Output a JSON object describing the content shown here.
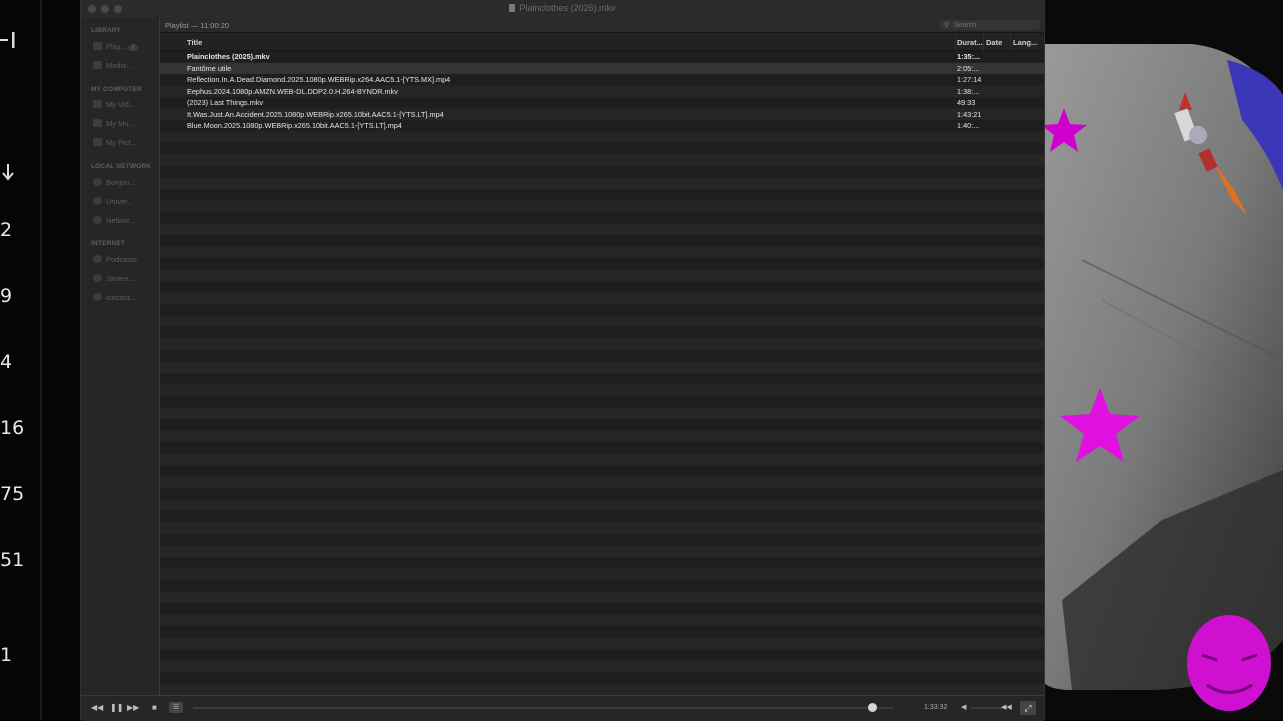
{
  "background_left": {
    "numbers": [
      "2",
      "9",
      "4",
      "16",
      "75",
      "51",
      "1"
    ]
  },
  "window": {
    "title": "Plainclothes (2026).mkv"
  },
  "sidebar": {
    "sections": [
      {
        "heading": "LIBRARY",
        "items": [
          {
            "label": "Play...",
            "icon": "playlist-icon",
            "badge": "7"
          },
          {
            "label": "Media...",
            "icon": "media-library-icon"
          }
        ]
      },
      {
        "heading": "MY COMPUTER",
        "items": [
          {
            "label": "My Vid...",
            "icon": "video-folder-icon"
          },
          {
            "label": "My Mu...",
            "icon": "music-note-icon"
          },
          {
            "label": "My Pict...",
            "icon": "picture-folder-icon"
          }
        ]
      },
      {
        "heading": "LOCAL NETWORK",
        "items": [
          {
            "label": "Bonjou...",
            "icon": "network-globe-icon"
          },
          {
            "label": "Univer...",
            "icon": "network-globe-icon"
          },
          {
            "label": "Networ...",
            "icon": "network-globe-icon"
          }
        ]
      },
      {
        "heading": "INTERNET",
        "items": [
          {
            "label": "Podcasts",
            "icon": "podcast-icon"
          },
          {
            "label": "Jamen...",
            "icon": "podcast-icon"
          },
          {
            "label": "Icecast...",
            "icon": "podcast-icon"
          }
        ]
      }
    ]
  },
  "playlist": {
    "header_label": "Playlist — 11:00:20",
    "search_placeholder": "Search",
    "columns": {
      "title": "Title",
      "duration": "Durat...",
      "date": "Date",
      "language": "Lang..."
    },
    "rows": [
      {
        "title": "Plainclothes (2025).mkv",
        "duration": "1:35:...",
        "playing": true
      },
      {
        "title": "Fantôme utile",
        "duration": "2:05:...",
        "selected": true
      },
      {
        "title": "Reflection.In.A.Dead.Diamond.2025.1080p.WEBRip.x264.AAC5.1-[YTS.MX].mp4",
        "duration": "1:27:14"
      },
      {
        "title": "Eephus.2024.1080p.AMZN.WEB-DL.DDP2.0.H.264-BYNDR.mkv",
        "duration": "1:38:..."
      },
      {
        "title": "(2023) Last Things.mkv",
        "duration": "49:33"
      },
      {
        "title": "It.Was.Just.An.Accident.2025.1080p.WEBRip.x265.10bit.AAC5.1-[YTS.LT].mp4",
        "duration": "1:43:21"
      },
      {
        "title": "Blue.Moon.2025.1080p.WEBRip.x265.10bit.AAC5.1-[YTS.LT].mp4",
        "duration": "1:40:..."
      }
    ]
  },
  "controls": {
    "rewind": "◀◀",
    "pause": "❚❚",
    "forward": "▶▶",
    "stop": "■",
    "playlist_toggle": "☰",
    "time": "1:33:32",
    "seek_progress": 0.97,
    "volume_low": "◀",
    "volume_high": "◀◀",
    "fullscreen": "⤢"
  }
}
